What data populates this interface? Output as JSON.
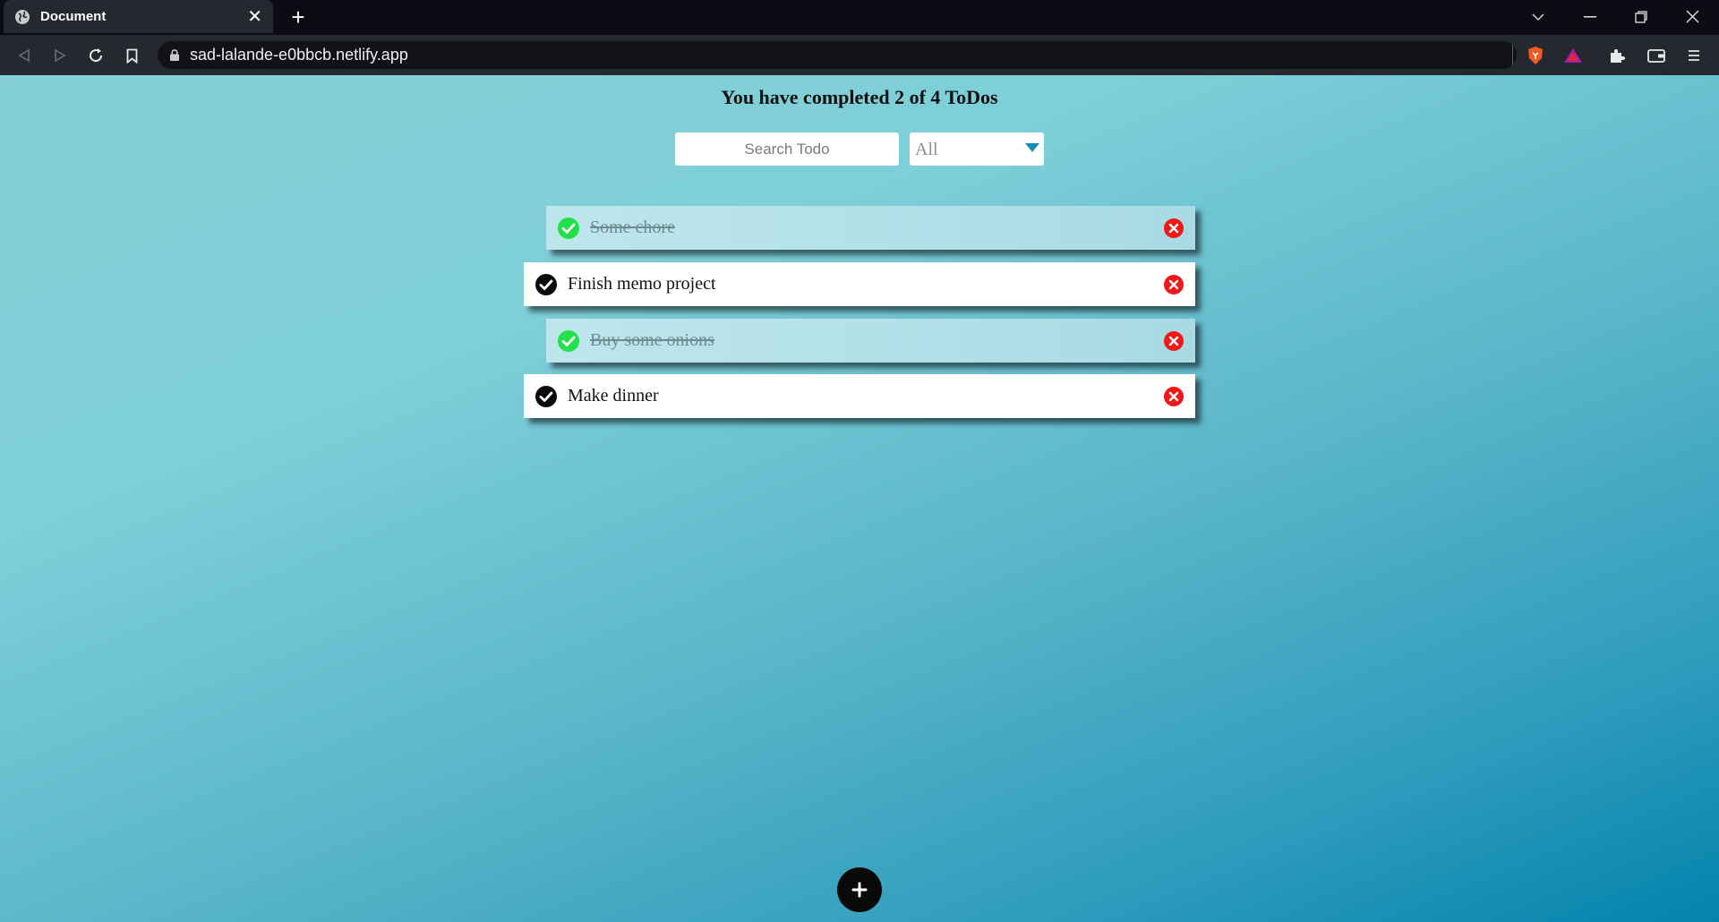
{
  "browser": {
    "tab_title": "Document",
    "url": "sad-lalande-e0bbcb.netlify.app"
  },
  "app": {
    "heading": "You have completed 2 of 4 ToDos",
    "search_placeholder": "Search Todo",
    "filter_selected": "All",
    "todos": [
      {
        "text": "Some chore",
        "completed": true
      },
      {
        "text": "Finish memo project",
        "completed": false
      },
      {
        "text": "Buy some onions",
        "completed": true
      },
      {
        "text": "Make dinner",
        "completed": false
      }
    ]
  },
  "colors": {
    "done_check": "#22e04a",
    "delete": "#f01818",
    "select_caret": "#1a8ab8"
  },
  "icons": [
    "globe-icon",
    "close-icon",
    "plus-icon",
    "back-icon",
    "forward-icon",
    "reload-icon",
    "bookmark-icon",
    "lock-icon",
    "brave-shield-icon",
    "brave-rewards-icon",
    "extensions-icon",
    "wallet-icon",
    "menu-icon",
    "check-circle-icon",
    "delete-circle-icon"
  ]
}
